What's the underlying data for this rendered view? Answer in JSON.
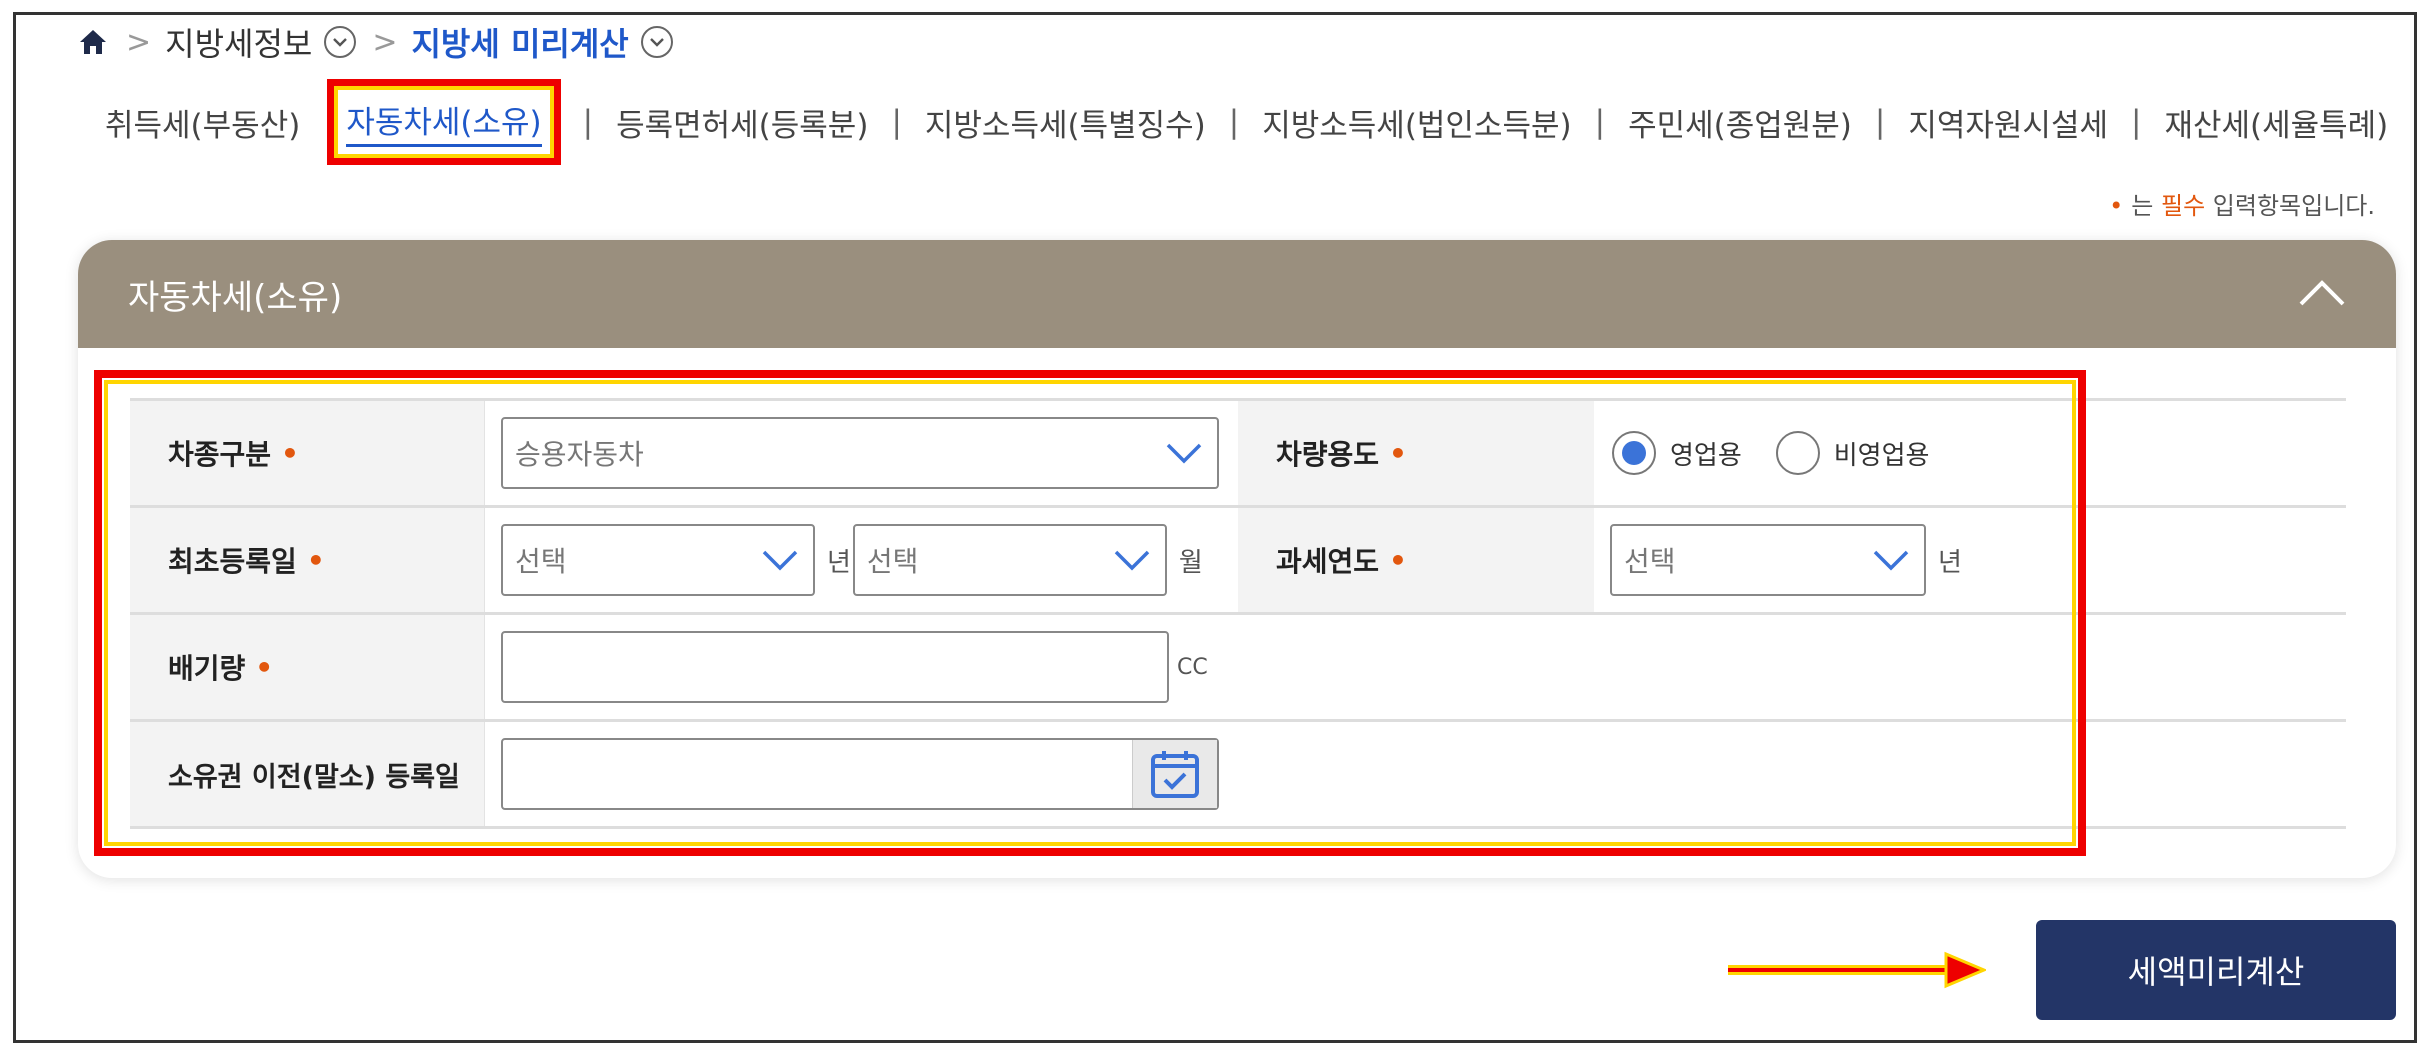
{
  "breadcrumb": {
    "level1": "지방세정보",
    "level2": "지방세 미리계산"
  },
  "tabs": [
    "취득세(부동산)",
    "자동차세(소유)",
    "등록면허세(등록분)",
    "지방소득세(특별징수)",
    "지방소득세(법인소득분)",
    "주민세(종업원분)",
    "지역자원시설세",
    "재산세(세율특례)"
  ],
  "required_note": {
    "marker": "•",
    "prefix": "는",
    "emphasis": "필수",
    "suffix": "입력항목입니다."
  },
  "panel": {
    "title": "자동차세(소유)"
  },
  "form": {
    "vehicle_type_label": "차종구분",
    "vehicle_type_value": "승용자동차",
    "usage_label": "차량용도",
    "usage_options": [
      "영업용",
      "비영업용"
    ],
    "usage_selected": "영업용",
    "first_reg_label": "최초등록일",
    "year_placeholder": "선택",
    "year_unit": "년",
    "month_placeholder": "선택",
    "month_unit": "월",
    "tax_year_label": "과세연도",
    "tax_year_placeholder": "선택",
    "tax_year_unit": "년",
    "displacement_label": "배기량",
    "displacement_unit": "CC",
    "transfer_label": "소유권 이전(말소) 등록일",
    "required_marker": "•"
  },
  "calc_button": "세액미리계산",
  "colors": {
    "accent_blue": "#1f58c9",
    "panel_header": "#9a8f7e",
    "button_navy": "#233567",
    "required_orange": "#e2570e",
    "highlight_red": "#ee0000",
    "highlight_yellow": "#ffd500"
  }
}
